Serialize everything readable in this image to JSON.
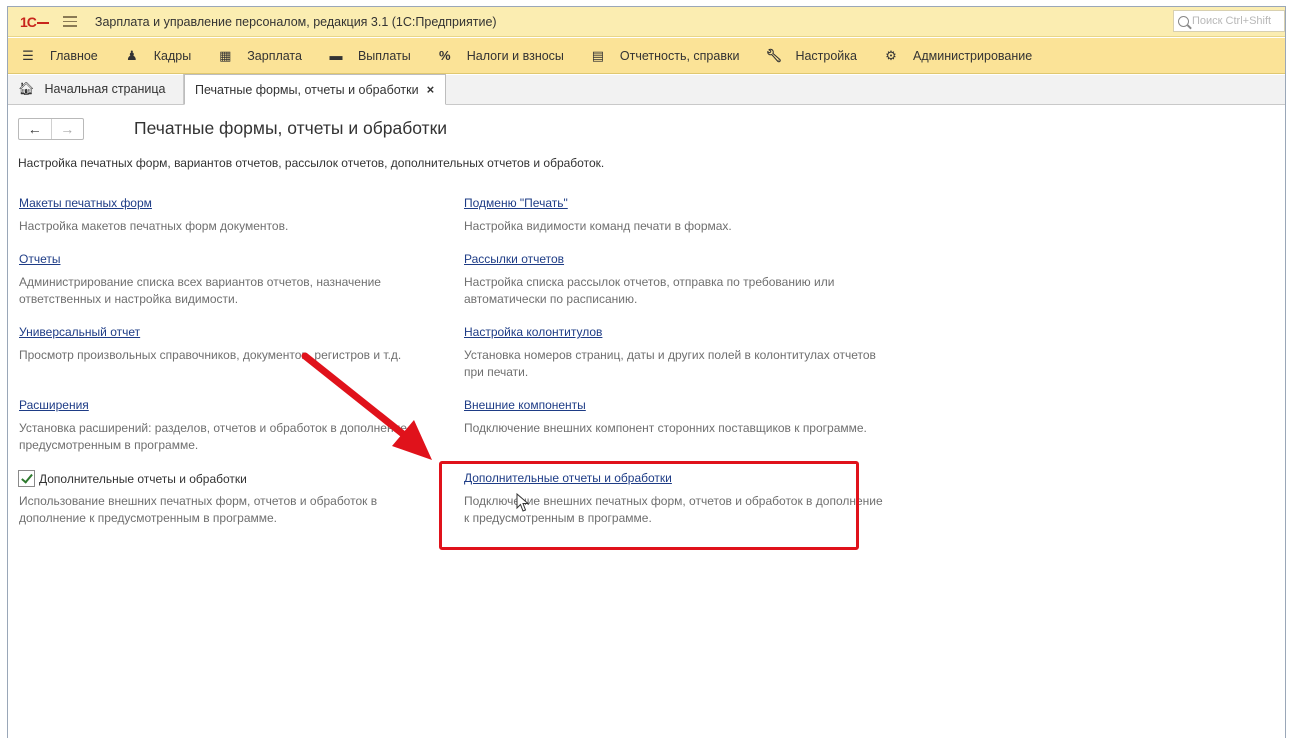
{
  "app": {
    "title": "Зарплата и управление персоналом, редакция 3.1  (1С:Предприятие)",
    "search_placeholder": "Поиск Ctrl+Shift",
    "logo": "1С"
  },
  "menu": [
    {
      "label": "Главное",
      "icon": "menu-lines-icon"
    },
    {
      "label": "Кадры",
      "icon": "people-icon"
    },
    {
      "label": "Зарплата",
      "icon": "calculator-icon"
    },
    {
      "label": "Выплаты",
      "icon": "cash-icon"
    },
    {
      "label": "Налоги и взносы",
      "icon": "percent-icon"
    },
    {
      "label": "Отчетность, справки",
      "icon": "document-icon"
    },
    {
      "label": "Настройка",
      "icon": "wrench-icon"
    },
    {
      "label": "Администрирование",
      "icon": "gear-icon"
    }
  ],
  "tabs": {
    "home": "Начальная страница",
    "active": "Печатные формы, отчеты и обработки",
    "close": "×"
  },
  "page": {
    "title": "Печатные формы, отчеты и обработки",
    "description": "Настройка печатных форм, вариантов отчетов, рассылок отчетов, дополнительных отчетов и обработок."
  },
  "left_items": [
    {
      "link": "Макеты печатных форм",
      "desc": "Настройка макетов печатных форм документов."
    },
    {
      "link": "Отчеты",
      "desc": "Администрирование списка всех вариантов отчетов, назначение ответственных и настройка видимости."
    },
    {
      "link": "Универсальный отчет",
      "desc": "Просмотр произвольных справочников, документов, регистров и т.д."
    },
    {
      "link": "Расширения",
      "desc": "Установка расширений: разделов, отчетов и обработок в дополнение к предусмотренным в программе."
    }
  ],
  "checkbox_item": {
    "label": "Дополнительные отчеты и обработки",
    "checked": true,
    "desc": "Использование внешних печатных форм, отчетов и обработок в дополнение к предусмотренным в программе."
  },
  "right_items": [
    {
      "link": "Подменю \"Печать\"",
      "desc": "Настройка видимости команд печати в формах."
    },
    {
      "link": "Рассылки отчетов",
      "desc": "Настройка списка рассылок отчетов, отправка по требованию или автоматически по расписанию."
    },
    {
      "link": "Настройка колонтитулов",
      "desc": "Установка номеров страниц, даты и других полей в колонтитулах отчетов при печати."
    },
    {
      "link": "Внешние компоненты",
      "desc": "Подключение внешних компонент сторонних поставщиков к программе."
    },
    {
      "link": "Дополнительные отчеты и обработки",
      "desc": "Подключение внешних печатных форм, отчетов и обработок в дополнение к предусмотренным в программе."
    }
  ],
  "colors": {
    "title_bar": "#fbedb1",
    "menu_bar": "#fbe397",
    "link": "#1e3c86",
    "highlight": "#e0121b"
  }
}
